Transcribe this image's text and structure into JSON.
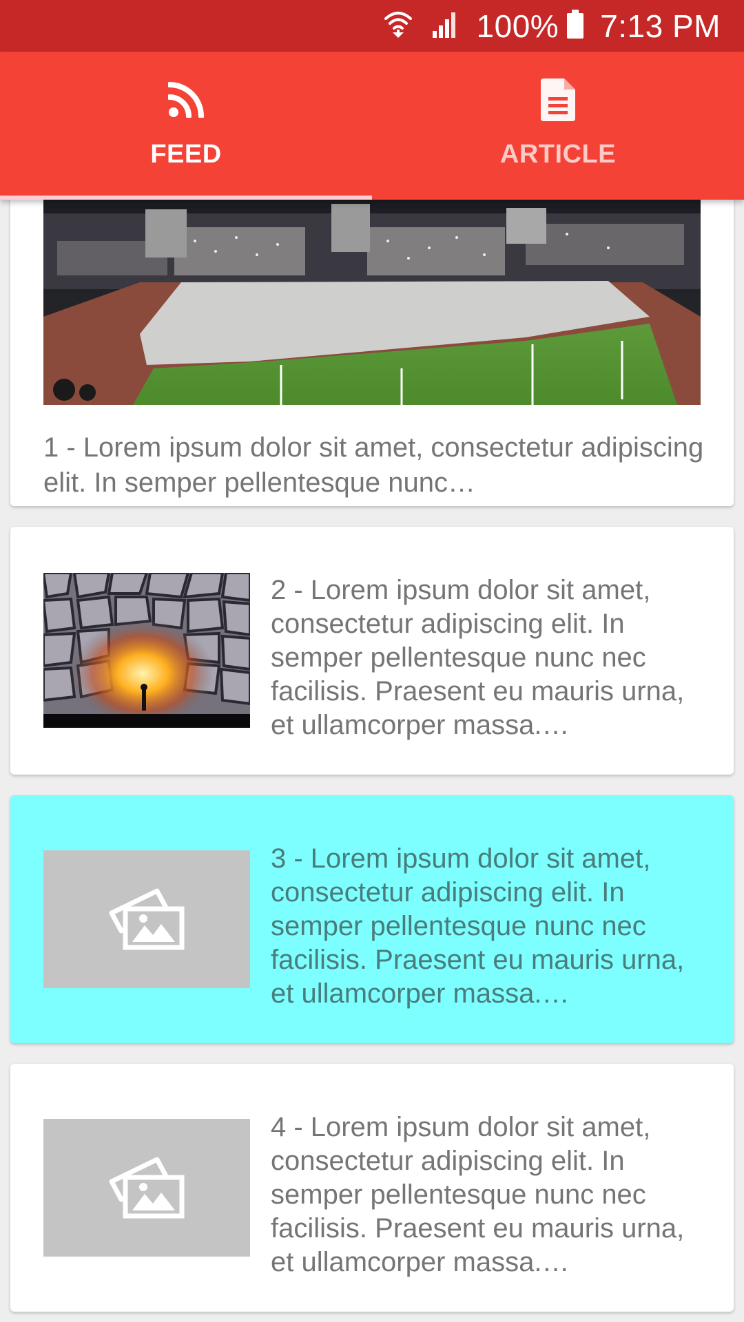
{
  "status_bar": {
    "battery_percent": "100%",
    "time": "7:13 PM",
    "icons": [
      "wifi-icon",
      "signal-icon",
      "battery-icon"
    ]
  },
  "tabs": [
    {
      "label": "FEED",
      "icon": "rss-icon",
      "selected": true
    },
    {
      "label": "ARTICLE",
      "icon": "document-icon",
      "selected": false
    }
  ],
  "feed": {
    "items": [
      {
        "text": "1 - Lorem ipsum dolor sit amet, consectetur adipiscing elit. In semper pellentesque nunc…",
        "image": "stadium-photo"
      },
      {
        "text": "2 - Lorem ipsum dolor sit amet, consectetur adipiscing elit. In semper pellentesque nunc nec facilisis. Praesent eu mauris urna, et ullamcorper massa.…",
        "image": "cracked-stone-photo"
      },
      {
        "text": "3 - Lorem ipsum dolor sit amet, consectetur adipiscing elit. In semper pellentesque nunc nec facilisis. Praesent eu mauris urna, et ullamcorper massa.…",
        "image": "image-placeholder-icon",
        "selected": true
      },
      {
        "text": "4 - Lorem ipsum dolor sit amet, consectetur adipiscing elit. In semper pellentesque nunc nec facilisis. Praesent eu mauris urna, et ullamcorper massa.…",
        "image": "image-placeholder-icon"
      }
    ]
  },
  "colors": {
    "status_bar": "#c62828",
    "tab_bar": "#f44336",
    "tab_indicator": "#ffcdd2",
    "selected_card": "#7cfffe",
    "placeholder": "#c4c4c4",
    "body_text": "#757575"
  }
}
